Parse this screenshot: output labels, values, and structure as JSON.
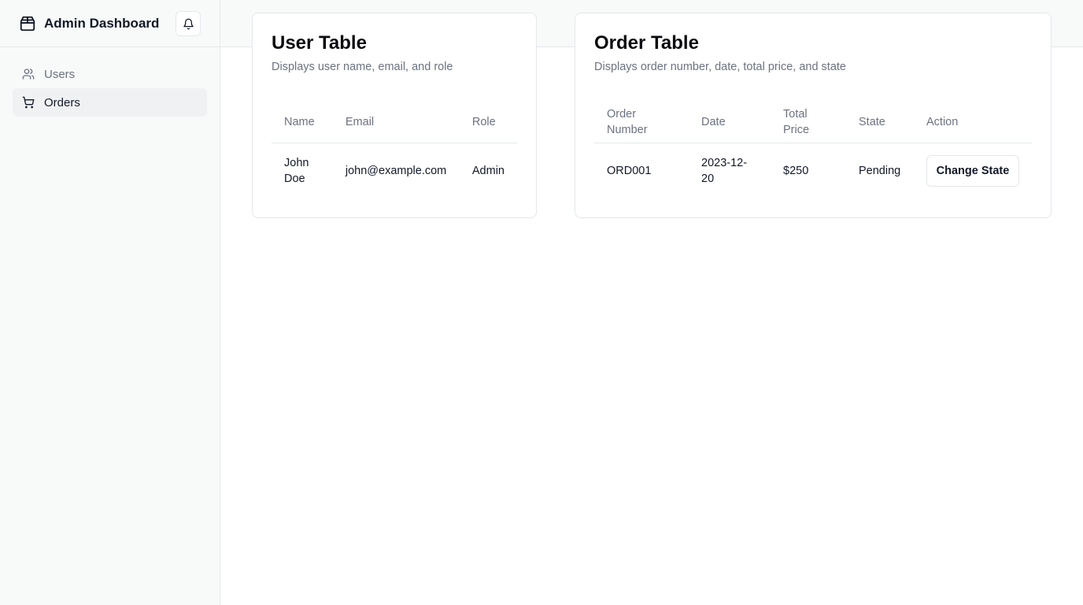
{
  "app": {
    "title": "Admin Dashboard"
  },
  "icons": {
    "logo": "package-icon",
    "notifications": "bell-icon",
    "users": "users-icon",
    "orders": "cart-icon"
  },
  "sidebar": {
    "items": [
      {
        "label": "Users",
        "icon": "users-icon",
        "active": false
      },
      {
        "label": "Orders",
        "icon": "cart-icon",
        "active": true
      }
    ]
  },
  "user_table": {
    "title": "User Table",
    "description": "Displays user name, email, and role",
    "columns": [
      "Name",
      "Email",
      "Role"
    ],
    "rows": [
      {
        "name": "John Doe",
        "email": "john@example.com",
        "role": "Admin"
      }
    ]
  },
  "order_table": {
    "title": "Order Table",
    "description": "Displays order number, date, total price, and state",
    "columns": [
      "Order Number",
      "Date",
      "Total Price",
      "State",
      "Action"
    ],
    "rows": [
      {
        "order_number": "ORD001",
        "date": "2023-12-20",
        "total_price": "$250",
        "state": "Pending",
        "action_label": "Change State"
      }
    ]
  },
  "colors": {
    "sidebar_bg": "#f8faf9",
    "border": "#e5e7eb",
    "muted_text": "#6b7280",
    "active_bg": "#eff1f3"
  }
}
